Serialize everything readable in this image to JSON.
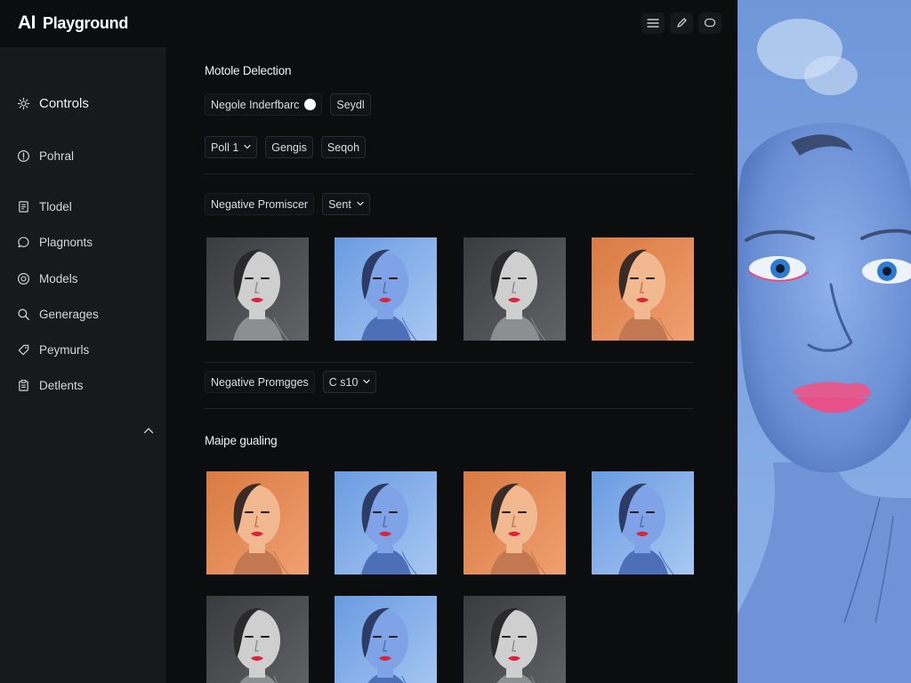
{
  "app": {
    "logo_text": "AI",
    "title": "Playground"
  },
  "topbar": {
    "icons": [
      "menu-icon",
      "pencil-icon",
      "chat-bubble-icon"
    ]
  },
  "sidebar": {
    "items": [
      {
        "label": "Controls",
        "icon": "gear-icon"
      },
      {
        "label": "Pohral",
        "icon": "info-circle-icon"
      },
      {
        "label": "Tlodel",
        "icon": "document-icon"
      },
      {
        "label": "Plagnonts",
        "icon": "chat-icon"
      },
      {
        "label": "Models",
        "icon": "target-icon"
      },
      {
        "label": "Generages",
        "icon": "search-icon"
      },
      {
        "label": "Peymurls",
        "icon": "tag-icon"
      },
      {
        "label": "Detlents",
        "icon": "clipboard-icon"
      }
    ],
    "collapse_icon": "chevron-up-icon"
  },
  "main": {
    "section1_title": "Motole Delection",
    "toggle_label": "Negole Inderfbarc",
    "toggle_on": true,
    "seydl_label": "Seydl",
    "poll_select": "Poll 1",
    "gengis_label": "Gengis",
    "seqoh_label": "Seqoh",
    "negative_label_1": "Negative Promiscer",
    "sent_select": "Sent",
    "negative_label_2": "Negative Promgges",
    "cs_select": "C s10",
    "section2_title": "Maipe gualing"
  },
  "thumbnails": {
    "row1": [
      "gray",
      "blue",
      "gray",
      "orange"
    ],
    "row2": [
      "orange",
      "blue",
      "orange",
      "blue"
    ],
    "row3": [
      "gray",
      "blue",
      "gray"
    ]
  },
  "colors": {
    "bg": "#0c0d0f",
    "sidebar": "#18191c",
    "gray": "#5a5c60",
    "blue": "#6f9fe3",
    "orange": "#e5874f"
  }
}
